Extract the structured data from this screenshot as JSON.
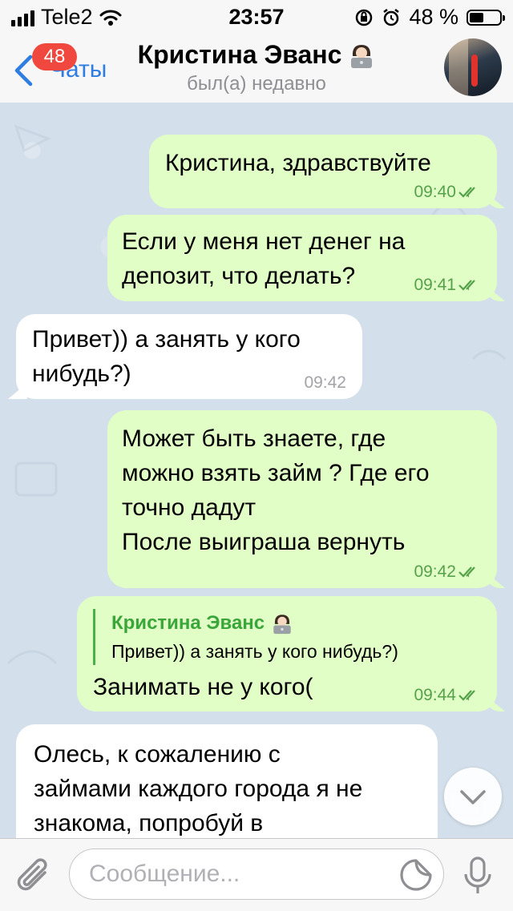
{
  "status_bar": {
    "carrier": "Tele2",
    "time": "23:57",
    "battery_percent": "48 %",
    "battery_level": 0.48
  },
  "header": {
    "back_label": "Чаты",
    "unread_badge": "48",
    "title": "Кристина Эванс",
    "title_emoji": "woman-technologist-emoji",
    "subtitle": "был(а) недавно"
  },
  "messages": [
    {
      "direction": "out",
      "text": "Кристина, здравствуйте",
      "time": "09:40",
      "status": "read"
    },
    {
      "direction": "out",
      "text": "Если у меня нет денег на\nдепозит, что делать?",
      "time": "09:41",
      "status": "read"
    },
    {
      "direction": "in",
      "text": "Привет)) а занять у кого\nнибудь?)",
      "time": "09:42"
    },
    {
      "direction": "out",
      "text": "Может быть знаете, где\nможно взять займ ? Где его\nточно дадут\nПосле выиграша вернуть",
      "time": "09:42",
      "status": "read"
    },
    {
      "direction": "out",
      "reply_author": "Кристина Эванс",
      "reply_text": "Привет)) а занять у кого нибудь?)",
      "text": "Занимать не у кого(",
      "time": "09:44",
      "status": "read"
    },
    {
      "direction": "in",
      "text": "Олесь, к сожалению с\nзаймами каждого города я не\nзнакома, попробуй в"
    }
  ],
  "input": {
    "placeholder": "Сообщение..."
  },
  "colors": {
    "accent": "#2f7de1",
    "badge": "#f0483e",
    "outgoing_bubble": "#e1fec6",
    "incoming_bubble": "#ffffff",
    "outgoing_time": "#55a14a",
    "chat_background": "#d3dfea"
  }
}
